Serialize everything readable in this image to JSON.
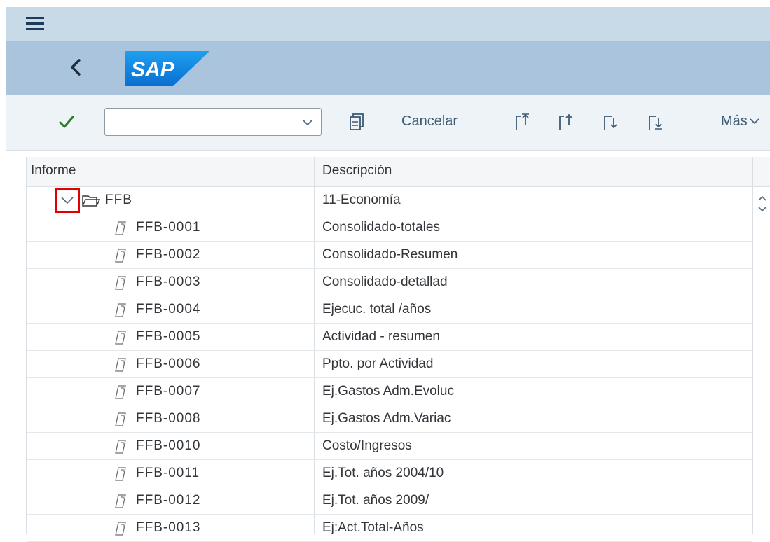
{
  "toolbar": {
    "combo_value": "",
    "cancel_label": "Cancelar",
    "more_label": "Más"
  },
  "table": {
    "headers": {
      "informe": "Informe",
      "descripcion": "Descripción"
    },
    "root": {
      "label": "FFB",
      "description": "11-Economía"
    },
    "rows": [
      {
        "label": "FFB-0001",
        "description": "Consolidado-totales"
      },
      {
        "label": "FFB-0002",
        "description": "Consolidado-Resumen"
      },
      {
        "label": "FFB-0003",
        "description": "Consolidado-detallad"
      },
      {
        "label": "FFB-0004",
        "description": "Ejecuc. total /años"
      },
      {
        "label": "FFB-0005",
        "description": "Actividad - resumen"
      },
      {
        "label": "FFB-0006",
        "description": "Ppto. por Actividad"
      },
      {
        "label": "FFB-0007",
        "description": "Ej.Gastos Adm.Evoluc"
      },
      {
        "label": "FFB-0008",
        "description": "Ej.Gastos Adm.Variac"
      },
      {
        "label": "FFB-0010",
        "description": "Costo/Ingresos"
      },
      {
        "label": "FFB-0011",
        "description": "Ej.Tot. años 2004/10"
      },
      {
        "label": "FFB-0012",
        "description": "Ej.Tot. años 2009/"
      },
      {
        "label": "FFB-0013",
        "description": "Ej:Act.Total-Años"
      }
    ]
  },
  "icons": {
    "menu": "hamburger-icon",
    "back": "chevron-left-icon",
    "check": "checkmark-icon",
    "report": "report-icon",
    "folder": "folder-icon"
  },
  "colors": {
    "top_bar": "#c8d9e8",
    "title_bar": "#a9c4dc",
    "sap_logo": "#0a6ed1",
    "check": "#2b7d2b",
    "highlight_box": "#e00000"
  }
}
